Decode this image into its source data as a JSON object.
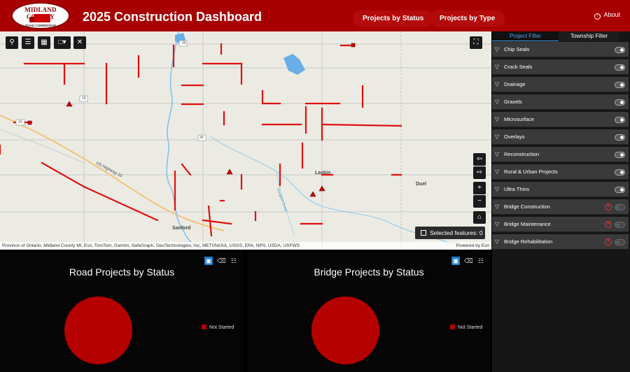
{
  "header": {
    "logo_top": "MIDLAND COUNTY",
    "logo_bottom": "ROAD COMMISSION",
    "title": "2025 Construction Dashboard",
    "nav": [
      "Projects by Status",
      "Projects by Type"
    ],
    "about": "About",
    "brand_color": "#a80000"
  },
  "map": {
    "places": [
      "Sanford",
      "Laskin",
      "Duel"
    ],
    "highway_label": "US Highway 10",
    "route_shields": [
      "30",
      "18",
      "30",
      "10"
    ],
    "creek_label": "Sturgeon Creek",
    "attribution": "Province of Ontario, Midland County MI, Esri, TomTom, Garmin, SafeGraph, GeoTechnologies, Inc, METI/NASA, USGS, EPA, NPS, USDA, USFWS",
    "powered_by": "Powered by Esri",
    "selected_features": "Selected features: 0",
    "road_color": "#e01010"
  },
  "charts": [
    {
      "title": "Road Projects by Status",
      "chart_data": {
        "type": "pie",
        "categories": [
          "Not Started"
        ],
        "values": [
          1
        ],
        "colors": [
          "#b50000"
        ],
        "legend": "right"
      }
    },
    {
      "title": "Bridge Projects by Status",
      "chart_data": {
        "type": "pie",
        "categories": [
          "Not Started"
        ],
        "values": [
          1
        ],
        "colors": [
          "#b50000"
        ],
        "legend": "right"
      }
    }
  ],
  "sidebar": {
    "tabs": [
      "Project Filter",
      "Township Filter"
    ],
    "filters": [
      {
        "label": "Chip Seals",
        "error": false
      },
      {
        "label": "Crack Seals",
        "error": false
      },
      {
        "label": "Drainage",
        "error": false
      },
      {
        "label": "Gravels",
        "error": false
      },
      {
        "label": "Microsurface",
        "error": false
      },
      {
        "label": "Overlays",
        "error": false
      },
      {
        "label": "Reconstruction",
        "error": false
      },
      {
        "label": "Rural & Urban Projects",
        "error": false
      },
      {
        "label": "Ultra Thins",
        "error": false
      },
      {
        "label": "Bridge Construction",
        "error": true
      },
      {
        "label": "Bridge Maintenance",
        "error": true
      },
      {
        "label": "Bridge Rehabilitation",
        "error": true
      }
    ]
  }
}
